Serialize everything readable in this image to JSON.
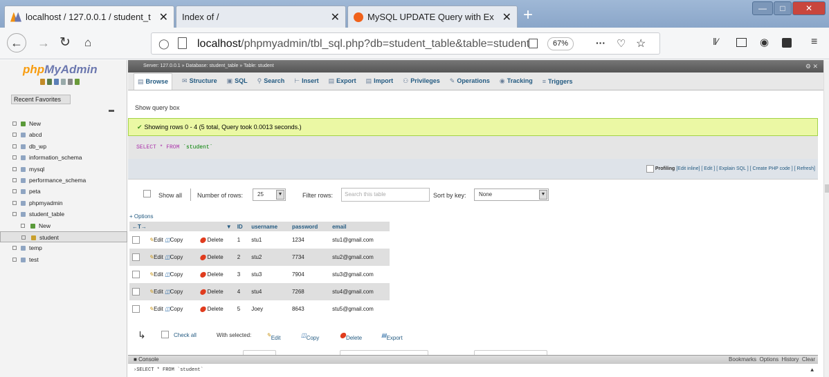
{
  "browser": {
    "tabs": [
      {
        "title": "localhost / 127.0.0.1 / student_t",
        "icon": "phpmyadmin-favicon"
      },
      {
        "title": "Index of /",
        "icon": "none"
      },
      {
        "title": "MySQL UPDATE Query with Ex",
        "icon": "mysql-favicon"
      }
    ],
    "close_glyph": "✕",
    "new_tab": "+",
    "url_host": "localhost",
    "url_path": "/phpmyadmin/tbl_sql.php?db=student_table&table=student",
    "zoom": "67%",
    "more": "···"
  },
  "pma": {
    "logo_php": "php",
    "logo_my": "MyAdmin",
    "recent": "Recent",
    "favorites": "Favorites",
    "tree": [
      {
        "label": "New",
        "indent": 0,
        "type": "new"
      },
      {
        "label": "abcd",
        "indent": 0,
        "type": "db"
      },
      {
        "label": "db_wp",
        "indent": 0,
        "type": "db"
      },
      {
        "label": "information_schema",
        "indent": 0,
        "type": "db"
      },
      {
        "label": "mysql",
        "indent": 0,
        "type": "db"
      },
      {
        "label": "performance_schema",
        "indent": 0,
        "type": "db"
      },
      {
        "label": "peta",
        "indent": 0,
        "type": "db"
      },
      {
        "label": "phpmyadmin",
        "indent": 0,
        "type": "db"
      },
      {
        "label": "student_table",
        "indent": 0,
        "type": "db"
      },
      {
        "label": "New",
        "indent": 1,
        "type": "new"
      },
      {
        "label": "student",
        "indent": 1,
        "type": "table",
        "selected": true
      },
      {
        "label": "temp",
        "indent": 0,
        "type": "db"
      },
      {
        "label": "test",
        "indent": 0,
        "type": "db"
      }
    ],
    "breadcrumb": {
      "server": "Server: 127.0.0.1 »",
      "database": "Database: student_table »",
      "table": "Table: student"
    },
    "menu": [
      "Browse",
      "Structure",
      "SQL",
      "Search",
      "Insert",
      "Export",
      "Import",
      "Privileges",
      "Operations",
      "Tracking",
      "Triggers"
    ],
    "show_query_box": "Show query box",
    "success_msg": "Showing rows 0 - 4 (5 total, Query took 0.0013 seconds.)",
    "sql_keywords": "SELECT * FROM",
    "sql_table": "`student`",
    "profiling": {
      "label": "Profiling",
      "links": "[Edit inline] [ Edit ] [ Explain SQL ] [ Create PHP code ] [ Refresh]"
    },
    "nav": {
      "show_all": "Show all",
      "number_of_rows": "Number of rows:",
      "rows_value": "25",
      "filter_rows": "Filter rows:",
      "filter_placeholder": "Search this table",
      "sort_by_key": "Sort by key:",
      "sort_value": "None"
    },
    "options": "+ Options",
    "columns": [
      "ID",
      "username",
      "password",
      "email"
    ],
    "row_actions": {
      "edit": "Edit",
      "copy": "Copy",
      "delete": "Delete"
    },
    "rows": [
      {
        "id": "1",
        "username": "stu1",
        "password": "1234",
        "email": "stu1@gmail.com"
      },
      {
        "id": "2",
        "username": "stu2",
        "password": "7734",
        "email": "stu2@gmail.com"
      },
      {
        "id": "3",
        "username": "stu3",
        "password": "7904",
        "email": "stu3@gmail.com"
      },
      {
        "id": "4",
        "username": "stu4",
        "password": "7268",
        "email": "stu4@gmail.com"
      },
      {
        "id": "5",
        "username": "Joey",
        "password": "8643",
        "email": "stu5@gmail.com"
      }
    ],
    "bulk": {
      "check_all": "Check all",
      "with_selected": "With selected:",
      "edit": "Edit",
      "copy": "Copy",
      "delete": "Delete",
      "export": "Export"
    },
    "console": {
      "title": "Console",
      "bookmarks": "Bookmarks",
      "options": "Options",
      "history": "History",
      "clear": "Clear",
      "last_query": "›SELECT * FROM `student`"
    }
  }
}
